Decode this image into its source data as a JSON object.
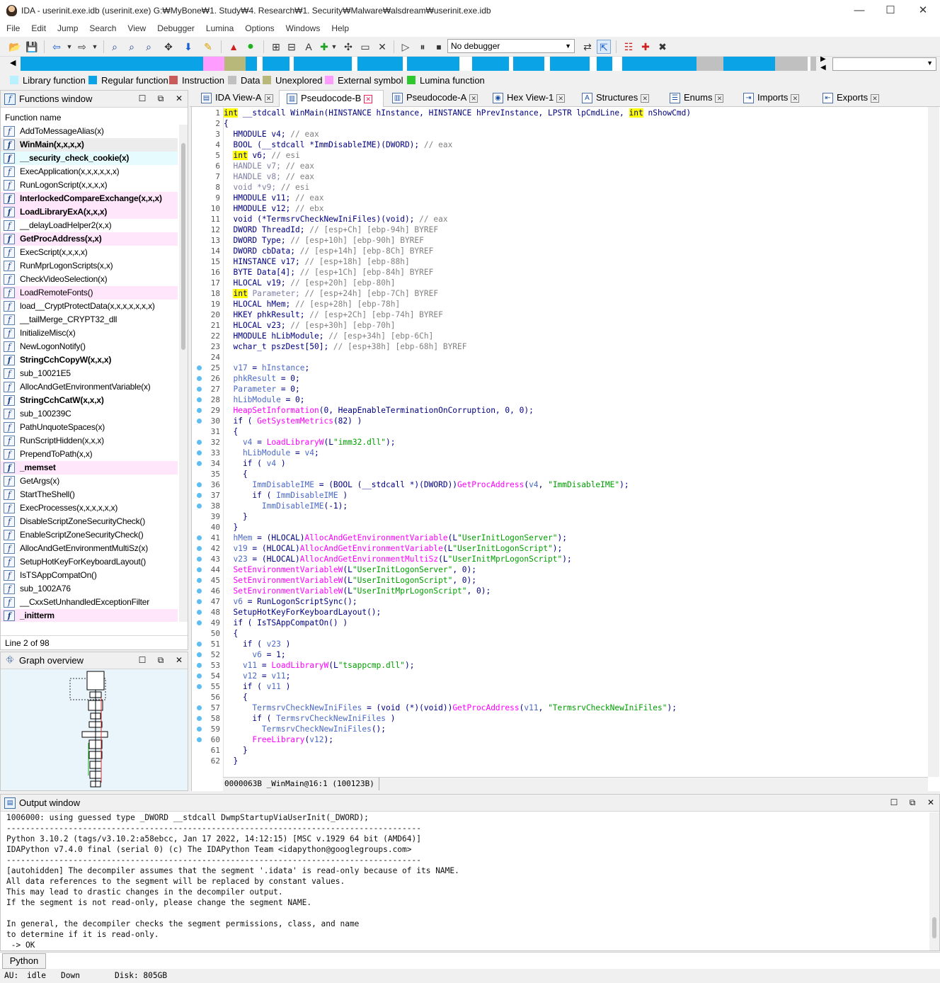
{
  "window": {
    "title": "IDA - userinit.exe.idb (userinit.exe) G:₩MyBone₩1. Study₩4. Research₩1. Security₩Malware₩alsdream₩userinit.exe.idb"
  },
  "menu": [
    "File",
    "Edit",
    "Jump",
    "Search",
    "View",
    "Debugger",
    "Lumina",
    "Options",
    "Windows",
    "Help"
  ],
  "toolbar": {
    "debugger": "No debugger"
  },
  "legend": [
    {
      "label": "Library function",
      "color": "#b8f0ff"
    },
    {
      "label": "Regular function",
      "color": "#0aa3e6"
    },
    {
      "label": "Instruction",
      "color": "#c85a5a"
    },
    {
      "label": "Data",
      "color": "#c0c0c0"
    },
    {
      "label": "Unexplored",
      "color": "#b8b87a"
    },
    {
      "label": "External symbol",
      "color": "#ff9cff"
    },
    {
      "label": "Lumina function",
      "color": "#2ec82e"
    }
  ],
  "functions": {
    "title": "Functions window",
    "column": "Function name",
    "items": [
      {
        "name": "AddToMessageAlias(x)",
        "style": ""
      },
      {
        "name": "WinMain(x,x,x,x)",
        "style": "b sel"
      },
      {
        "name": "__security_check_cookie(x)",
        "style": "b cyan"
      },
      {
        "name": "ExecApplication(x,x,x,x,x,x)",
        "style": ""
      },
      {
        "name": "RunLogonScript(x,x,x,x)",
        "style": ""
      },
      {
        "name": "InterlockedCompareExchange(x,x,x)",
        "style": "b pink"
      },
      {
        "name": "LoadLibraryExA(x,x,x)",
        "style": "b pink"
      },
      {
        "name": "__delayLoadHelper2(x,x)",
        "style": ""
      },
      {
        "name": "GetProcAddress(x,x)",
        "style": "b pink"
      },
      {
        "name": "ExecScript(x,x,x,x)",
        "style": ""
      },
      {
        "name": "RunMprLogonScripts(x,x)",
        "style": ""
      },
      {
        "name": "CheckVideoSelection(x)",
        "style": ""
      },
      {
        "name": "LoadRemoteFonts()",
        "style": "pink"
      },
      {
        "name": "load__CryptProtectData(x,x,x,x,x,x,x)",
        "style": ""
      },
      {
        "name": "__tailMerge_CRYPT32_dll",
        "style": ""
      },
      {
        "name": "InitializeMisc(x)",
        "style": ""
      },
      {
        "name": "NewLogonNotify()",
        "style": ""
      },
      {
        "name": "StringCchCopyW(x,x,x)",
        "style": "b"
      },
      {
        "name": "sub_10021E5",
        "style": ""
      },
      {
        "name": "AllocAndGetEnvironmentVariable(x)",
        "style": ""
      },
      {
        "name": "StringCchCatW(x,x,x)",
        "style": "b"
      },
      {
        "name": "sub_100239C",
        "style": ""
      },
      {
        "name": "PathUnquoteSpaces(x)",
        "style": ""
      },
      {
        "name": "RunScriptHidden(x,x,x)",
        "style": ""
      },
      {
        "name": "PrependToPath(x,x)",
        "style": ""
      },
      {
        "name": "_memset",
        "style": "b pink"
      },
      {
        "name": "GetArgs(x)",
        "style": ""
      },
      {
        "name": "StartTheShell()",
        "style": ""
      },
      {
        "name": "ExecProcesses(x,x,x,x,x,x)",
        "style": ""
      },
      {
        "name": "DisableScriptZoneSecurityCheck()",
        "style": ""
      },
      {
        "name": "EnableScriptZoneSecurityCheck()",
        "style": ""
      },
      {
        "name": "AllocAndGetEnvironmentMultiSz(x)",
        "style": ""
      },
      {
        "name": "SetupHotKeyForKeyboardLayout()",
        "style": ""
      },
      {
        "name": "IsTSAppCompatOn()",
        "style": ""
      },
      {
        "name": "sub_1002A76",
        "style": ""
      },
      {
        "name": "__CxxSetUnhandledExceptionFilter",
        "style": ""
      },
      {
        "name": "_initterm",
        "style": "b pink"
      }
    ],
    "status": "Line 2 of 98"
  },
  "graph": {
    "title": "Graph overview"
  },
  "tabs": [
    {
      "label": "IDA View-A",
      "icon": "▤",
      "w": 118
    },
    {
      "label": "Pseudocode-B",
      "icon": "▥",
      "w": 148,
      "active": true
    },
    {
      "label": "Pseudocode-A",
      "icon": "▥",
      "w": 140
    },
    {
      "label": "Hex View-1",
      "icon": "◉",
      "w": 124
    },
    {
      "label": "Structures",
      "icon": "A",
      "w": 122
    },
    {
      "label": "Enums",
      "icon": "☰",
      "w": 102
    },
    {
      "label": "Imports",
      "icon": "⇥",
      "w": 110
    },
    {
      "label": "Exports",
      "icon": "⇤",
      "w": 94
    }
  ],
  "code": {
    "dots": [
      25,
      26,
      27,
      28,
      29,
      30,
      32,
      33,
      34,
      36,
      37,
      38,
      41,
      42,
      43,
      44,
      45,
      46,
      47,
      48,
      49,
      51,
      52,
      53,
      54,
      55,
      57,
      58,
      59,
      60
    ],
    "lines": [
      [
        [
          "hi",
          "int"
        ],
        [
          "k",
          " __stdcall WinMain(HINSTANCE hInstance, HINSTANCE hPrevInstance, LPSTR lpCmdLine, "
        ],
        [
          "hi",
          "int"
        ],
        [
          "k",
          " nShowCmd)"
        ]
      ],
      [
        [
          "k",
          "{"
        ]
      ],
      [
        [
          "k",
          "  HMODULE v4; "
        ],
        [
          "c",
          "// eax"
        ]
      ],
      [
        [
          "k",
          "  BOOL (__stdcall *ImmDisableIME)(DWORD); "
        ],
        [
          "c",
          "// eax"
        ]
      ],
      [
        [
          "k",
          "  "
        ],
        [
          "hi",
          "int"
        ],
        [
          "k",
          " v6; "
        ],
        [
          "c",
          "// esi"
        ]
      ],
      [
        [
          "g",
          "  HANDLE v7; "
        ],
        [
          "c",
          "// eax"
        ]
      ],
      [
        [
          "g",
          "  HANDLE v8; "
        ],
        [
          "c",
          "// eax"
        ]
      ],
      [
        [
          "g",
          "  void *v9; "
        ],
        [
          "c",
          "// esi"
        ]
      ],
      [
        [
          "k",
          "  HMODULE v11; "
        ],
        [
          "c",
          "// eax"
        ]
      ],
      [
        [
          "k",
          "  HMODULE v12; "
        ],
        [
          "c",
          "// ebx"
        ]
      ],
      [
        [
          "k",
          "  void (*TermsrvCheckNewIniFiles)(void); "
        ],
        [
          "c",
          "// eax"
        ]
      ],
      [
        [
          "k",
          "  DWORD ThreadId; "
        ],
        [
          "c",
          "// [esp+Ch] [ebp-94h] BYREF"
        ]
      ],
      [
        [
          "k",
          "  DWORD Type; "
        ],
        [
          "c",
          "// [esp+10h] [ebp-90h] BYREF"
        ]
      ],
      [
        [
          "k",
          "  DWORD cbData; "
        ],
        [
          "c",
          "// [esp+14h] [ebp-8Ch] BYREF"
        ]
      ],
      [
        [
          "k",
          "  HINSTANCE v17; "
        ],
        [
          "c",
          "// [esp+18h] [ebp-88h]"
        ]
      ],
      [
        [
          "k",
          "  BYTE Data[4]; "
        ],
        [
          "c",
          "// [esp+1Ch] [ebp-84h] BYREF"
        ]
      ],
      [
        [
          "k",
          "  HLOCAL v19; "
        ],
        [
          "c",
          "// [esp+20h] [ebp-80h]"
        ]
      ],
      [
        [
          "k",
          "  "
        ],
        [
          "hi",
          "int"
        ],
        [
          "g",
          " Parameter; "
        ],
        [
          "c",
          "// [esp+24h] [ebp-7Ch] BYREF"
        ]
      ],
      [
        [
          "k",
          "  HLOCAL hMem; "
        ],
        [
          "c",
          "// [esp+28h] [ebp-78h]"
        ]
      ],
      [
        [
          "k",
          "  HKEY phkResult; "
        ],
        [
          "c",
          "// [esp+2Ch] [ebp-74h] BYREF"
        ]
      ],
      [
        [
          "k",
          "  HLOCAL v23; "
        ],
        [
          "c",
          "// [esp+30h] [ebp-70h]"
        ]
      ],
      [
        [
          "k",
          "  HMODULE hLibModule; "
        ],
        [
          "c",
          "// [esp+34h] [ebp-6Ch]"
        ]
      ],
      [
        [
          "k",
          "  wchar_t pszDest[50]; "
        ],
        [
          "c",
          "// [esp+38h] [ebp-68h] BYREF"
        ]
      ],
      [
        [
          "k",
          ""
        ]
      ],
      [
        [
          "v",
          "  v17"
        ],
        [
          "k",
          " = "
        ],
        [
          "v",
          "hInstance"
        ],
        [
          "k",
          ";"
        ]
      ],
      [
        [
          "v",
          "  phkResult"
        ],
        [
          "k",
          " = 0;"
        ]
      ],
      [
        [
          "v",
          "  Parameter"
        ],
        [
          "k",
          " = 0;"
        ]
      ],
      [
        [
          "v",
          "  hLibModule"
        ],
        [
          "k",
          " = 0;"
        ]
      ],
      [
        [
          "f",
          "  HeapSetInformation"
        ],
        [
          "k",
          "(0, HeapEnableTerminationOnCorruption, 0, 0);"
        ]
      ],
      [
        [
          "k",
          "  if ( "
        ],
        [
          "f",
          "GetSystemMetrics"
        ],
        [
          "k",
          "(82) )"
        ]
      ],
      [
        [
          "k",
          "  {"
        ]
      ],
      [
        [
          "v",
          "    v4"
        ],
        [
          "k",
          " = "
        ],
        [
          "f",
          "LoadLibraryW"
        ],
        [
          "k",
          "(L"
        ],
        [
          "s",
          "\"imm32.dll\""
        ],
        [
          "k",
          ");"
        ]
      ],
      [
        [
          "v",
          "    hLibModule"
        ],
        [
          "k",
          " = "
        ],
        [
          "v",
          "v4"
        ],
        [
          "k",
          ";"
        ]
      ],
      [
        [
          "k",
          "    if ( "
        ],
        [
          "v",
          "v4"
        ],
        [
          "k",
          " )"
        ]
      ],
      [
        [
          "k",
          "    {"
        ]
      ],
      [
        [
          "v",
          "      ImmDisableIME"
        ],
        [
          "k",
          " = (BOOL (__stdcall *)(DWORD))"
        ],
        [
          "f",
          "GetProcAddress"
        ],
        [
          "k",
          "("
        ],
        [
          "v",
          "v4"
        ],
        [
          "k",
          ", "
        ],
        [
          "s",
          "\"ImmDisableIME\""
        ],
        [
          "k",
          ");"
        ]
      ],
      [
        [
          "k",
          "      if ( "
        ],
        [
          "v",
          "ImmDisableIME"
        ],
        [
          "k",
          " )"
        ]
      ],
      [
        [
          "v",
          "        ImmDisableIME"
        ],
        [
          "k",
          "(-1);"
        ]
      ],
      [
        [
          "k",
          "    }"
        ]
      ],
      [
        [
          "k",
          "  }"
        ]
      ],
      [
        [
          "v",
          "  hMem"
        ],
        [
          "k",
          " = (HLOCAL)"
        ],
        [
          "f",
          "AllocAndGetEnvironmentVariable"
        ],
        [
          "k",
          "(L"
        ],
        [
          "s",
          "\"UserInitLogonServer\""
        ],
        [
          "k",
          ");"
        ]
      ],
      [
        [
          "v",
          "  v19"
        ],
        [
          "k",
          " = (HLOCAL)"
        ],
        [
          "f",
          "AllocAndGetEnvironmentVariable"
        ],
        [
          "k",
          "(L"
        ],
        [
          "s",
          "\"UserInitLogonScript\""
        ],
        [
          "k",
          ");"
        ]
      ],
      [
        [
          "v",
          "  v23"
        ],
        [
          "k",
          " = (HLOCAL)"
        ],
        [
          "f",
          "AllocAndGetEnvironmentMultiSz"
        ],
        [
          "k",
          "(L"
        ],
        [
          "s",
          "\"UserInitMprLogonScript\""
        ],
        [
          "k",
          ");"
        ]
      ],
      [
        [
          "f",
          "  SetEnvironmentVariableW"
        ],
        [
          "k",
          "(L"
        ],
        [
          "s",
          "\"UserInitLogonServer\""
        ],
        [
          "k",
          ", 0);"
        ]
      ],
      [
        [
          "f",
          "  SetEnvironmentVariableW"
        ],
        [
          "k",
          "(L"
        ],
        [
          "s",
          "\"UserInitLogonScript\""
        ],
        [
          "k",
          ", 0);"
        ]
      ],
      [
        [
          "f",
          "  SetEnvironmentVariableW"
        ],
        [
          "k",
          "(L"
        ],
        [
          "s",
          "\"UserInitMprLogonScript\""
        ],
        [
          "k",
          ", 0);"
        ]
      ],
      [
        [
          "v",
          "  v6"
        ],
        [
          "k",
          " = "
        ],
        [
          "k",
          "RunLogonScriptSync();"
        ]
      ],
      [
        [
          "k",
          "  SetupHotKeyForKeyboardLayout();"
        ]
      ],
      [
        [
          "k",
          "  if ( IsTSAppCompatOn() )"
        ]
      ],
      [
        [
          "k",
          "  {"
        ]
      ],
      [
        [
          "k",
          "    if ( "
        ],
        [
          "v",
          "v23"
        ],
        [
          "k",
          " )"
        ]
      ],
      [
        [
          "v",
          "      v6"
        ],
        [
          "k",
          " = 1;"
        ]
      ],
      [
        [
          "v",
          "    v11"
        ],
        [
          "k",
          " = "
        ],
        [
          "f",
          "LoadLibraryW"
        ],
        [
          "k",
          "(L"
        ],
        [
          "s",
          "\"tsappcmp.dll\""
        ],
        [
          "k",
          ");"
        ]
      ],
      [
        [
          "v",
          "    v12"
        ],
        [
          "k",
          " = "
        ],
        [
          "v",
          "v11"
        ],
        [
          "k",
          ";"
        ]
      ],
      [
        [
          "k",
          "    if ( "
        ],
        [
          "v",
          "v11"
        ],
        [
          "k",
          " )"
        ]
      ],
      [
        [
          "k",
          "    {"
        ]
      ],
      [
        [
          "v",
          "      TermsrvCheckNewIniFiles"
        ],
        [
          "k",
          " = (void (*)(void))"
        ],
        [
          "f",
          "GetProcAddress"
        ],
        [
          "k",
          "("
        ],
        [
          "v",
          "v11"
        ],
        [
          "k",
          ", "
        ],
        [
          "s",
          "\"TermsrvCheckNewIniFiles\""
        ],
        [
          "k",
          ");"
        ]
      ],
      [
        [
          "k",
          "      if ( "
        ],
        [
          "v",
          "TermsrvCheckNewIniFiles"
        ],
        [
          "k",
          " )"
        ]
      ],
      [
        [
          "v",
          "        TermsrvCheckNewIniFiles"
        ],
        [
          "k",
          "();"
        ]
      ],
      [
        [
          "f",
          "      FreeLibrary"
        ],
        [
          "k",
          "("
        ],
        [
          "v",
          "v12"
        ],
        [
          "k",
          ");"
        ]
      ],
      [
        [
          "k",
          "    }"
        ]
      ],
      [
        [
          "k",
          "  }"
        ]
      ]
    ],
    "status": "0000063B _WinMain@16:1 (100123B)"
  },
  "output": {
    "title": "Output window",
    "text": "1006000: using guessed type _DWORD __stdcall DwmpStartupViaUserInit(_DWORD);\n---------------------------------------------------------------------------------------\nPython 3.10.2 (tags/v3.10.2:a58ebcc, Jan 17 2022, 14:12:15) [MSC v.1929 64 bit (AMD64)]\nIDAPython v7.4.0 final (serial 0) (c) The IDAPython Team <idapython@googlegroups.com>\n---------------------------------------------------------------------------------------\n[autohidden] The decompiler assumes that the segment '.idata' is read-only because of its NAME.\nAll data references to the segment will be replaced by constant values.\nThis may lead to drastic changes in the decompiler output.\nIf the segment is not read-only, please change the segment NAME.\n\nIn general, the decompiler checks the segment permissions, class, and name\nto determine if it is read-only.\n -> OK"
  },
  "python": {
    "button": "Python"
  },
  "status": {
    "au": "AU:",
    "state": "idle",
    "dir": "Down",
    "disk": "Disk: 805GB"
  }
}
